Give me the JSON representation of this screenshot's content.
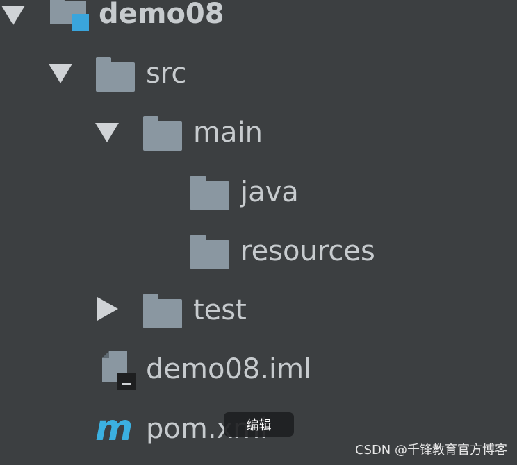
{
  "project_tree": {
    "root": {
      "label": "demo08",
      "icon": "module-folder-icon",
      "expanded": true
    },
    "src": {
      "label": "src",
      "icon": "folder-icon",
      "expanded": true
    },
    "main": {
      "label": "main",
      "icon": "folder-icon",
      "expanded": true
    },
    "java": {
      "label": "java",
      "icon": "folder-icon"
    },
    "resources": {
      "label": "resources",
      "icon": "folder-icon"
    },
    "test": {
      "label": "test",
      "icon": "folder-icon",
      "expanded": false
    },
    "iml": {
      "label": "demo08.iml",
      "icon": "iml-file-icon"
    },
    "pom": {
      "label": "pom.xml",
      "icon": "maven-icon"
    }
  },
  "tooltip": {
    "text": "编辑"
  },
  "watermark": {
    "text": "CSDN @千锋教育官方博客"
  },
  "colors": {
    "background": "#3c3f41",
    "text": "#c7cbce",
    "folder": "#8a97a1",
    "module_accent": "#3aa5dc",
    "maven_accent": "#3bb0e0"
  }
}
